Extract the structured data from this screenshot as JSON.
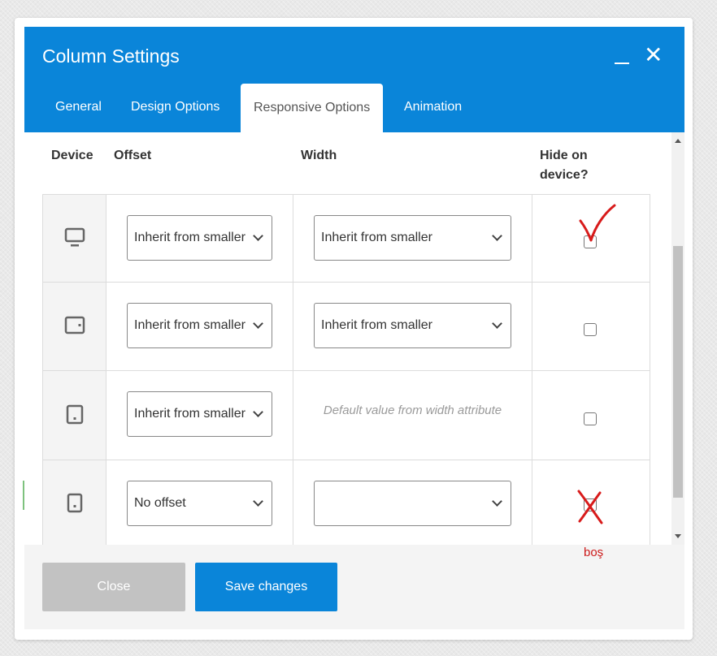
{
  "dialog": {
    "title": "Column Settings",
    "minimize_icon": "minimize-icon",
    "close_icon": "close-icon",
    "close_glyph": "✕"
  },
  "tabs": [
    {
      "label": "General",
      "active": false
    },
    {
      "label": "Design Options",
      "active": false
    },
    {
      "label": "Responsive Options",
      "active": true
    },
    {
      "label": "Animation",
      "active": false
    }
  ],
  "table": {
    "headers": {
      "device": "Device",
      "offset": "Offset",
      "width": "Width",
      "hide": "Hide on device?"
    },
    "rows": [
      {
        "device_icon": "desktop-icon",
        "offset": "Inherit from smaller",
        "width": "Inherit from smaller",
        "hide_checked": false
      },
      {
        "device_icon": "tablet-landscape-icon",
        "offset": "Inherit from smaller",
        "width": "Inherit from smaller",
        "hide_checked": false
      },
      {
        "device_icon": "tablet-portrait-icon",
        "offset": "Inherit from smaller",
        "width_placeholder": "Default value from width attribute",
        "hide_checked": false
      },
      {
        "device_icon": "mobile-icon",
        "offset": "No offset",
        "width": "",
        "hide_checked": false
      }
    ]
  },
  "footer": {
    "close_label": "Close",
    "save_label": "Save changes"
  },
  "annotations": {
    "note_text": "boş",
    "check_mark_icon": "red-check-mark-icon",
    "cross_mark_icon": "red-cross-mark-icon",
    "annotation_color": "#cc1a1a"
  },
  "colors": {
    "accent": "#0a85d9",
    "close_button": "#c2c2c2"
  }
}
